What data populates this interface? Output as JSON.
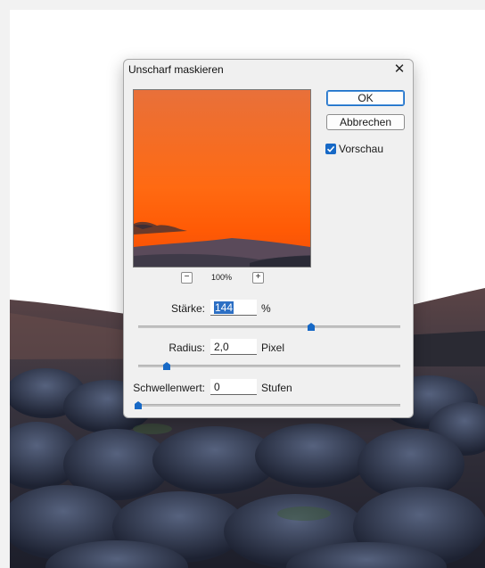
{
  "dialog": {
    "title": "Unscharf maskieren",
    "close_glyph": "✕",
    "ok_label": "OK",
    "cancel_label": "Abbrechen",
    "preview_checkbox": {
      "label": "Vorschau",
      "checked": true
    },
    "zoom": {
      "minus": "−",
      "plus": "+",
      "level": "100%"
    },
    "params": [
      {
        "label": "Stärke:",
        "value": "144",
        "unit": "%",
        "slider_fraction": 0.66
      },
      {
        "label": "Radius:",
        "value": "2,0",
        "unit": "Pixel",
        "slider_fraction": 0.11
      },
      {
        "label": "Schwellenwert:",
        "value": "0",
        "unit": "Stufen",
        "slider_fraction": 0.0
      }
    ]
  },
  "colors": {
    "accent": "#1769c6",
    "dialog_bg": "#f0f0f0",
    "sky_top": "#e8703a",
    "sky_bottom": "#ff5a05"
  }
}
